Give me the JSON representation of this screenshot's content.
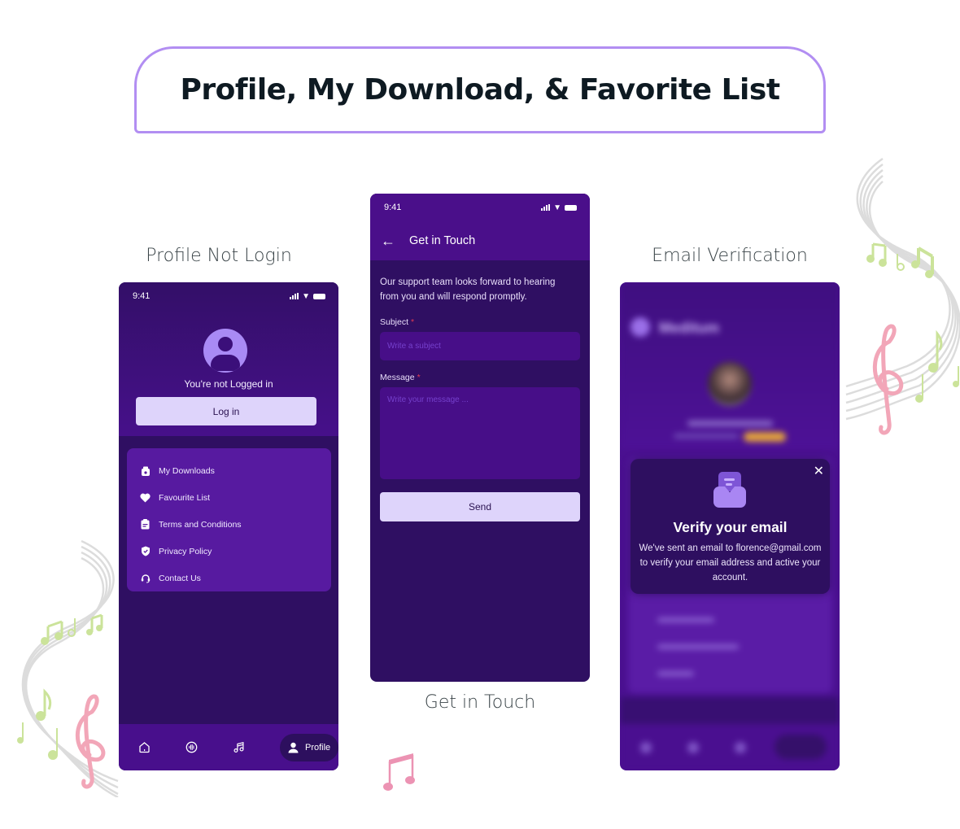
{
  "banner": {
    "title": "Profile, My Download, & Favorite List"
  },
  "captions": {
    "profile_not_login": "Profile Not Login",
    "get_in_touch": "Get in Touch",
    "email_verification": "Email Verification"
  },
  "colors": {
    "banner_border": "#b28ef2",
    "phone_bg": "#2f0f62",
    "header_purple": "#4a0f8a",
    "menu_card": "#571aa0",
    "button_light": "#ded4fb",
    "avatar_lilac": "#a98af5",
    "required_star": "#e23b53",
    "badge_orange": "#e3a33b"
  },
  "profile_screen": {
    "status_time": "9:41",
    "not_logged_text": "You're not Logged in",
    "login_button": "Log in",
    "menu": [
      {
        "icon": "download-bag-icon",
        "label": "My Downloads"
      },
      {
        "icon": "heart-icon",
        "label": "Favourite List"
      },
      {
        "icon": "clipboard-icon",
        "label": "Terms and Conditions"
      },
      {
        "icon": "shield-check-icon",
        "label": "Privacy Policy"
      },
      {
        "icon": "headset-icon",
        "label": "Contact Us"
      }
    ],
    "nav": {
      "items": [
        {
          "icon": "home-icon"
        },
        {
          "icon": "audio-wave-icon"
        },
        {
          "icon": "music-note-icon"
        }
      ],
      "active": {
        "icon": "user-icon",
        "label": "Profile"
      }
    }
  },
  "contact_screen": {
    "status_time": "9:41",
    "title": "Get in Touch",
    "intro": "Our support team looks forward to hearing from you and will respond promptly.",
    "subject_label": "Subject",
    "subject_placeholder": "Write a subject",
    "message_label": "Message",
    "message_placeholder": "Write your message ...",
    "required_mark": "*",
    "send_button": "Send"
  },
  "verify_screen": {
    "brand": "Meditum",
    "modal": {
      "title": "Verify your email",
      "body": "We've sent an email to florence@gmail.com to verify your email address and active your account."
    }
  }
}
